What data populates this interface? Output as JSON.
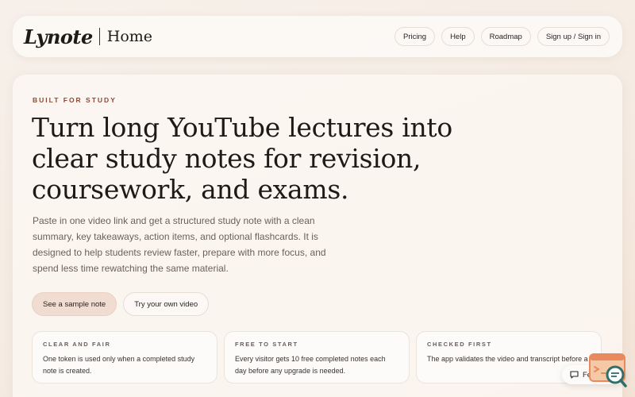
{
  "header": {
    "logo": "Lynote",
    "page_name": "Home",
    "nav": [
      {
        "label": "Pricing"
      },
      {
        "label": "Help"
      },
      {
        "label": "Roadmap"
      },
      {
        "label": "Sign up / Sign in"
      }
    ]
  },
  "hero": {
    "eyebrow": "BUILT FOR STUDY",
    "headline": "Turn long YouTube lectures into clear study notes for revision, coursework, and exams.",
    "subtext": "Paste in one video link and get a structured study note with a clean summary, key takeaways, action items, and optional flashcards. It is designed to help students review faster, prepare with more focus, and spend less time rewatching the same material.",
    "cta_primary": "See a sample note",
    "cta_secondary": "Try your own video"
  },
  "cards": [
    {
      "title": "CLEAR AND FAIR",
      "text": "One token is used only when a completed study note is created."
    },
    {
      "title": "FREE TO START",
      "text": "Every visitor gets 10 free completed notes each day before any upgrade is needed."
    },
    {
      "title": "CHECKED FIRST",
      "text": "The app validates the video and transcript before a note counts against your allow"
    }
  ],
  "feedback": {
    "label": "Feedback",
    "icon": "chat-icon"
  },
  "colors": {
    "accent": "#8a4a35",
    "primary_button": "#f1dcd2",
    "widget": "#e98a5e",
    "widget_teal": "#2f6f6a"
  }
}
